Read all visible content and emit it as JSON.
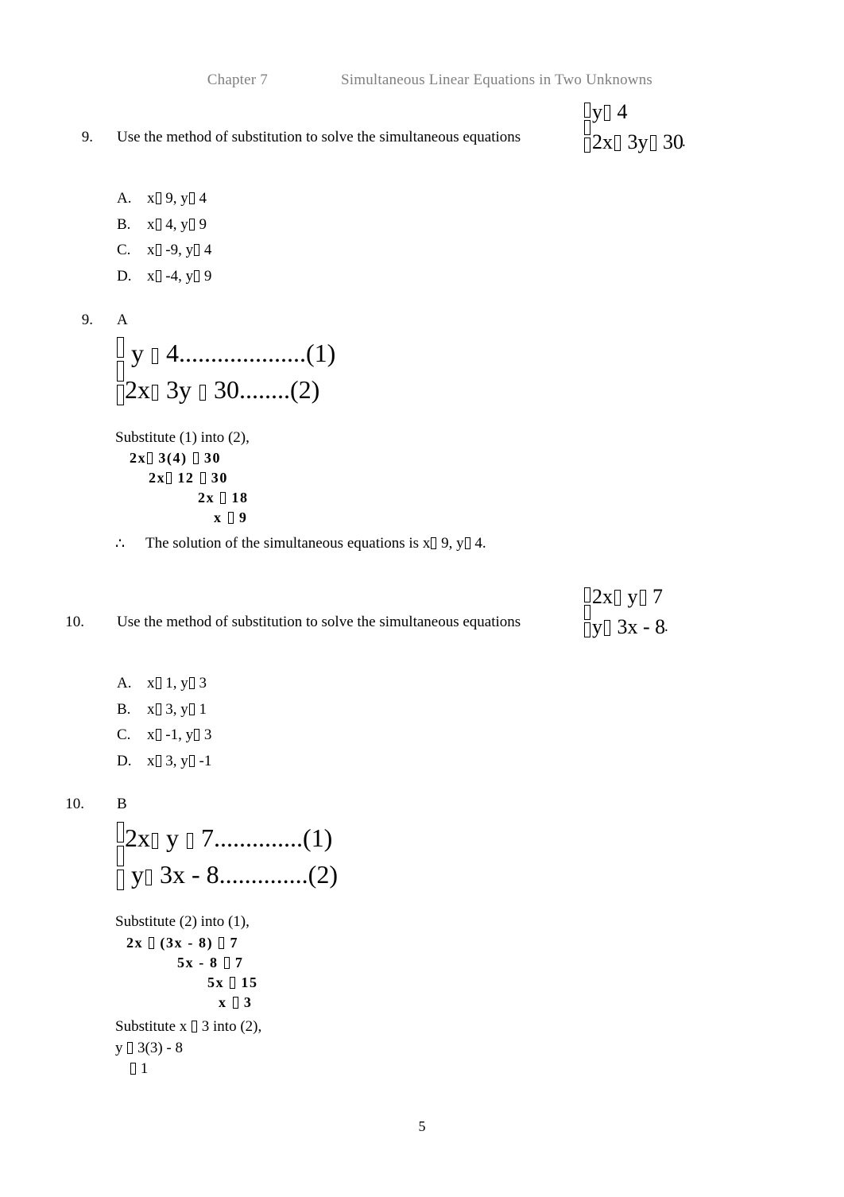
{
  "header": {
    "chapter": "Chapter 7",
    "title": "Simultaneous Linear Equations in Two Unknowns"
  },
  "page_number": "5",
  "questions": [
    {
      "number": "9.",
      "stem": "Use the method of substitution to solve the simultaneous equations",
      "period": ".",
      "system": {
        "line1": "y    4",
        "line1_pre": "",
        "line1_a": "y",
        "line1_b": "4",
        "line2_a": "2x",
        "line2_b": "3y",
        "line2_c": "30"
      },
      "options": [
        {
          "letter": "A.",
          "a": "x",
          "b": "9, y",
          "c": "4"
        },
        {
          "letter": "B.",
          "a": "x",
          "b": "4, y",
          "c": "9"
        },
        {
          "letter": "C.",
          "a": "x",
          "b": "-9, y",
          "c": "4"
        },
        {
          "letter": "D.",
          "a": "x",
          "b": "-4, y",
          "c": "9"
        }
      ]
    },
    {
      "number": "10.",
      "stem": "Use the method of substitution to solve the simultaneous equations",
      "period": ".",
      "system": {
        "line1_a": "2x",
        "line1_b": "y",
        "line1_c": "7",
        "line2_a": "y",
        "line2_b": "3x - 8"
      },
      "options": [
        {
          "letter": "A.",
          "a": "x",
          "b": "1, y",
          "c": "3"
        },
        {
          "letter": "B.",
          "a": "x",
          "b": "3, y",
          "c": "1"
        },
        {
          "letter": "C.",
          "a": "x",
          "b": "-1, y",
          "c": "3"
        },
        {
          "letter": "D.",
          "a": "x",
          "b": "3, y",
          "c": "-1"
        }
      ]
    }
  ],
  "answers": [
    {
      "number": "9.",
      "letter": "A",
      "system": {
        "eq1_a": "y",
        "eq1_b": "4",
        "eq1_leader": "....................",
        "eq1_label": "(1)",
        "eq2_a": "2x",
        "eq2_b": "3y",
        "eq2_c": "30",
        "eq2_leader": "........",
        "eq2_label": "(2)"
      },
      "substitute_line": "Substitute (1) into (2),",
      "steps": [
        {
          "a": "2x",
          "b": "3(4)",
          "c": "30",
          "indent": 18
        },
        {
          "a": "2x",
          "b": "12",
          "c": "30",
          "indent": 42
        },
        {
          "a": "2x",
          "b": "",
          "c": "18",
          "indent": 104
        },
        {
          "a": "x",
          "b": "",
          "c": "9",
          "indent": 124
        }
      ],
      "conclusion_symbol": "∴",
      "conclusion_pre": "The solution of the simultaneous equations is x",
      "conclusion_mid": "9, y",
      "conclusion_post": "4."
    },
    {
      "number": "10.",
      "letter": "B",
      "system": {
        "eq1_a": "2x",
        "eq1_b": "y",
        "eq1_c": "7",
        "eq1_leader": "..............",
        "eq1_label": "(1)",
        "eq2_a": "y",
        "eq2_b": "3x - 8",
        "eq2_leader": "..............",
        "eq2_label": "(2)"
      },
      "substitute_line": "Substitute (2) into (1),",
      "steps": [
        {
          "a": "2x",
          "b": "(3x - 8)",
          "c": "7",
          "indent": 14
        },
        {
          "a": "5x - 8",
          "b": "",
          "c": "7",
          "indent": 78
        },
        {
          "a": "5x",
          "b": "",
          "c": "15",
          "indent": 116
        },
        {
          "a": "x",
          "b": "",
          "c": "3",
          "indent": 130
        }
      ],
      "substitute_line2": "Substitute x",
      "substitute_line2_post": "3 into (2),",
      "final": [
        {
          "a": "y",
          "b": "3(3) - 8",
          "indent": 0
        },
        {
          "a": "",
          "b": "1",
          "indent": 20
        }
      ]
    }
  ]
}
